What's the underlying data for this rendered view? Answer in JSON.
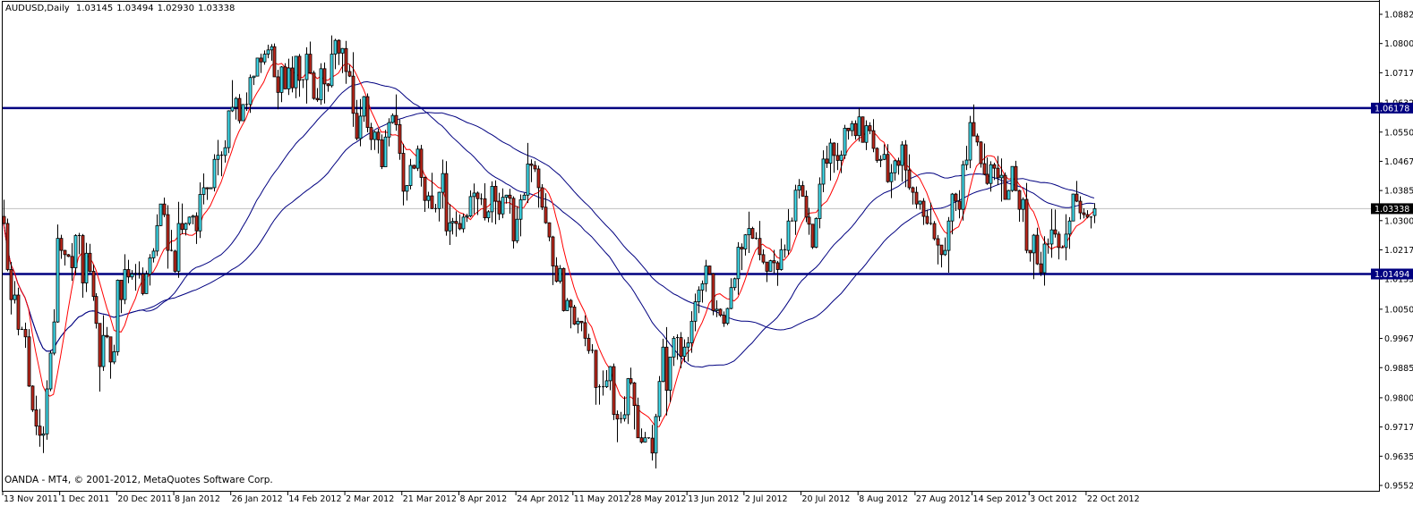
{
  "header": {
    "symbol": "AUDUSD,Daily",
    "open": "1.03145",
    "high": "1.03494",
    "low": "1.02930",
    "close": "1.03338"
  },
  "copyright": "OANDA - MT4, © 2001-2012, MetaQuotes Software Corp.",
  "chart_data": {
    "type": "candlestick",
    "title": "AUDUSD,Daily",
    "ylim": [
      0.95525,
      1.08825
    ],
    "grid": false,
    "y_ticks": [
      "1.08825",
      "1.08000",
      "1.07175",
      "1.06325",
      "1.05500",
      "1.04675",
      "1.03850",
      "1.03000",
      "1.02175",
      "1.01350",
      "1.00500",
      "0.99675",
      "0.98850",
      "0.98000",
      "0.97175",
      "0.96350",
      "0.95525"
    ],
    "x_tick_labels": [
      "13 Nov 2011",
      "1 Dec 2011",
      "20 Dec 2011",
      "8 Jan 2012",
      "26 Jan 2012",
      "14 Feb 2012",
      "2 Mar 2012",
      "21 Mar 2012",
      "8 Apr 2012",
      "24 Apr 2012",
      "11 May 2012",
      "28 May 2012",
      "13 Jun 2012",
      "2 Jul 2012",
      "20 Jul 2012",
      "8 Aug 2012",
      "27 Aug 2012",
      "14 Sep 2012",
      "3 Oct 2012",
      "22 Oct 2012"
    ],
    "closes": [
      1.0292,
      1.0162,
      1.0077,
      1.009,
      0.9993,
      0.9993,
      0.9972,
      0.9833,
      0.9766,
      0.972,
      0.9694,
      0.9698,
      0.9825,
      0.9926,
      1.0014,
      1.025,
      1.0216,
      1.0204,
      1.0199,
      1.0167,
      1.0258,
      1.0258,
      1.0124,
      1.0208,
      1.0157,
      1.0086,
      1.001,
      0.9888,
      0.9976,
      0.9972,
      0.9901,
      0.993,
      1.0132,
      1.0077,
      1.0162,
      1.0141,
      1.0149,
      1.0151,
      1.0149,
      1.0094,
      1.0149,
      1.0195,
      1.0214,
      1.0286,
      1.0347,
      1.0317,
      1.0216,
      1.0214,
      1.0157,
      1.0292,
      1.0275,
      1.0292,
      1.031,
      1.0313,
      1.0271,
      1.0374,
      1.0393,
      1.039,
      1.0393,
      1.0473,
      1.0485,
      1.0484,
      1.0506,
      1.061,
      1.062,
      1.0645,
      1.0582,
      1.0628,
      1.0628,
      1.0704,
      1.0708,
      1.0759,
      1.0748,
      1.077,
      1.0782,
      1.0791,
      1.0706,
      1.0662,
      1.0734,
      1.0672,
      1.0731,
      1.0675,
      1.0764,
      1.0696,
      1.0698,
      1.077,
      1.0717,
      1.0645,
      1.0641,
      1.0729,
      1.0686,
      1.0681,
      1.077,
      1.0809,
      1.0773,
      1.0786,
      1.0721,
      1.0708,
      1.0603,
      1.0532,
      1.0595,
      1.065,
      1.0563,
      1.0529,
      1.055,
      1.0528,
      1.0452,
      1.0536,
      1.0577,
      1.0597,
      1.0571,
      1.049,
      1.0383,
      1.0399,
      1.0456,
      1.0448,
      1.0502,
      1.0422,
      1.0357,
      1.037,
      1.0334,
      1.0334,
      1.038,
      1.0433,
      1.0271,
      1.0294,
      1.0298,
      1.0292,
      1.0277,
      1.031,
      1.0313,
      1.0368,
      1.0378,
      1.0362,
      1.0362,
      1.0308,
      1.0325,
      1.0397,
      1.0355,
      1.0319,
      1.0366,
      1.0372,
      1.0363,
      1.0243,
      1.0304,
      1.0359,
      1.0372,
      1.046,
      1.0456,
      1.0446,
      1.0393,
      1.0338,
      1.0294,
      1.0254,
      1.0172,
      1.0129,
      1.0165,
      1.0046,
      1.0075,
      1.0056,
      1.0008,
      1.0016,
      1.0012,
      0.9968,
      0.9933,
      0.9934,
      0.9829,
      0.9831,
      0.9831,
      0.9848,
      0.9888,
      0.9753,
      0.974,
      0.9741,
      0.9752,
      0.9854,
      0.9842,
      0.9778,
      0.9687,
      0.9675,
      0.9687,
      0.9686,
      0.9644,
      0.9747,
      0.9846,
      0.9943,
      0.9821,
      0.9915,
      0.9968,
      0.997,
      0.9917,
      0.9943,
      0.9955,
      1.0016,
      1.0071,
      1.0104,
      1.0122,
      1.0172,
      1.015,
      1.0046,
      1.005,
      1.0033,
      1.001,
      1.0052,
      1.0111,
      1.0136,
      1.0225,
      1.022,
      1.026,
      1.0278,
      1.025,
      1.025,
      1.0204,
      1.0183,
      1.0157,
      1.0187,
      1.0181,
      1.0162,
      1.0218,
      1.0216,
      1.0299,
      1.0299,
      1.0386,
      1.0399,
      1.0369,
      1.031,
      1.029,
      1.0225,
      1.0306,
      1.0403,
      1.0474,
      1.0462,
      1.0519,
      1.0484,
      1.047,
      1.0485,
      1.0561,
      1.0554,
      1.0574,
      1.054,
      1.0593,
      1.0521,
      1.0568,
      1.0554,
      1.0504,
      1.047,
      1.0473,
      1.0487,
      1.041,
      1.0435,
      1.0469,
      1.0456,
      1.0514,
      1.0443,
      1.0393,
      1.038,
      1.0347,
      1.0355,
      1.0312,
      1.0292,
      1.0292,
      1.0249,
      1.0231,
      1.0204,
      1.0216,
      1.0299,
      1.0375,
      1.0355,
      1.0332,
      1.0458,
      1.0471,
      1.0577,
      1.0539,
      1.0522,
      1.0461,
      1.0431,
      1.0405,
      1.0458,
      1.0448,
      1.0421,
      1.0428,
      1.036,
      1.0385,
      1.0453,
      1.0385,
      1.0332,
      1.036,
      1.0216,
      1.0209,
      1.0259,
      1.0178,
      1.0153,
      1.0234,
      1.0234,
      1.0274,
      1.0262,
      1.0224,
      1.0224,
      1.0262,
      1.0299,
      1.0375,
      1.0355,
      1.0322,
      1.0317,
      1.031,
      1.031,
      1.03338
    ],
    "last_bar": {
      "open": 1.03145,
      "high": 1.03494,
      "low": 1.0293,
      "close": 1.03338
    },
    "horizontal_lines": [
      {
        "value": "1.06178",
        "color": "#000080"
      },
      {
        "value": "1.01494",
        "color": "#000080"
      }
    ],
    "bid_line": {
      "value": "1.03338",
      "color": "#c0c0c0",
      "label_bg": "#000000"
    },
    "colors": {
      "bull_body": "#40e0f0",
      "bear_body": "#c0281c",
      "outline": "#000000",
      "fast_ma": "#ff0000",
      "slow_ma": "#000080"
    }
  }
}
